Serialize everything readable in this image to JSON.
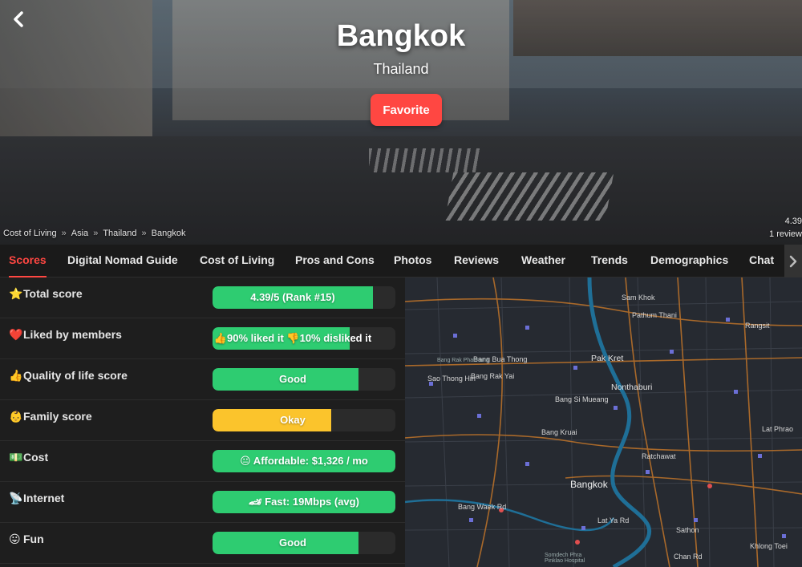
{
  "hero": {
    "title": "Bangkok",
    "country": "Thailand",
    "favorite_label": "Favorite",
    "breadcrumb": [
      "Cost of Living",
      "Asia",
      "Thailand",
      "Bangkok"
    ],
    "breadcrumb_sep": "»",
    "rating_value": "4.39",
    "rating_count": "1 review"
  },
  "tabs": [
    {
      "label": "Scores",
      "active": true
    },
    {
      "label": "Digital Nomad Guide"
    },
    {
      "label": "Cost of Living"
    },
    {
      "label": "Pros and Cons"
    },
    {
      "label": "Photos"
    },
    {
      "label": "Reviews"
    },
    {
      "label": "Weather"
    },
    {
      "label": "Trends"
    },
    {
      "label": "Demographics"
    },
    {
      "label": "Chat"
    }
  ],
  "scores": [
    {
      "emoji": "⭐",
      "label": "Total score",
      "value": "4.39/5 (Rank #15)",
      "fill": 0.878,
      "color": "#2ecc71"
    },
    {
      "emoji": "❤️",
      "label": "Liked by members",
      "value": "👍90% liked it 👎10% disliked it",
      "fill": 0.75,
      "color": "#2ecc71"
    },
    {
      "emoji": "👍",
      "label": "Quality of life score",
      "value": "Good",
      "fill": 0.8,
      "color": "#2ecc71"
    },
    {
      "emoji": "👶",
      "label": "Family score",
      "value": "Okay",
      "fill": 0.65,
      "color": "#fbc42c"
    },
    {
      "emoji": "💵",
      "label": "Cost",
      "value": "😐 Affordable: $1,326 / mo",
      "fill": 1.0,
      "color": "#2ecc71"
    },
    {
      "emoji": "📡",
      "label": "Internet",
      "value": "🏎 Fast: 19Mbps (avg)",
      "fill": 1.0,
      "color": "#2ecc71"
    },
    {
      "emoji": "😛",
      "label": "Fun",
      "value": "Good",
      "fill": 0.8,
      "color": "#2ecc71"
    }
  ],
  "map": {
    "labels": {
      "sam_khok": "Sam Khok",
      "pathum_thani": "Pathum Thani",
      "rangsit": "Rangsit",
      "pak_kret": "Pak Kret",
      "bang_bua_thong": "Bang Bua Thong",
      "bang_rak_phatthana": "Bang Rak Phatthana",
      "sao_thong_hin": "Sao Thong Hin",
      "bang_rak_yai": "Bang Rak Yai",
      "nonthaburi": "Nonthaburi",
      "bang_si_mueang": "Bang Si Mueang",
      "bang_kruai": "Bang Kruai",
      "lat_phrao": "Lat Phrao",
      "ratchawat": "Ratchawat",
      "bangkok": "Bangkok",
      "bang_waek_rd": "Bang Waek Rd",
      "lat_ya_rd": "Lat Ya Rd",
      "sathon": "Sathon",
      "chan_rd": "Chan Rd",
      "samdech_phra": "Somdech Phra\nPinklao Hospital",
      "khlong_toei": "Khlong Toei"
    }
  }
}
